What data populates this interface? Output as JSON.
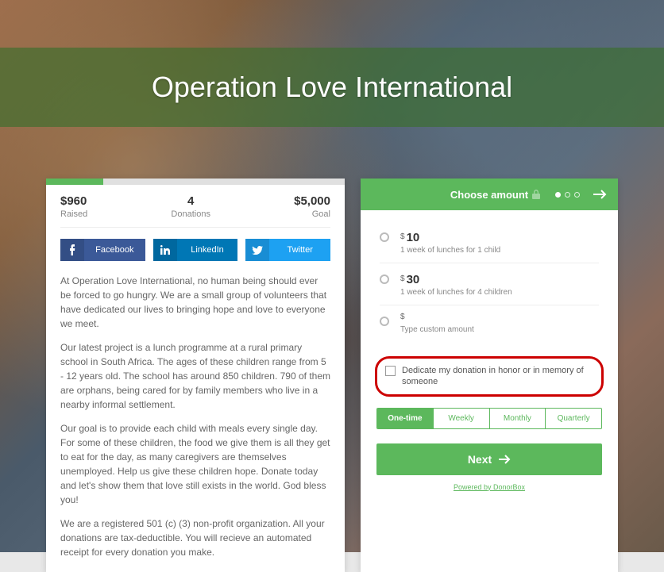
{
  "hero": {
    "title": "Operation Love International"
  },
  "stats": {
    "raised": {
      "value": "$960",
      "label": "Raised"
    },
    "donations": {
      "value": "4",
      "label": "Donations"
    },
    "goal": {
      "value": "$5,000",
      "label": "Goal"
    }
  },
  "social": {
    "facebook": "Facebook",
    "linkedin": "LinkedIn",
    "twitter": "Twitter"
  },
  "description": {
    "p1": "At Operation Love International, no human being should ever be forced to go hungry. We are a small group of volunteers that have dedicated our lives to bringing hope and love to everyone we meet.",
    "p2": "Our latest project is a lunch programme at a rural primary school in South Africa. The ages of these children range from 5 - 12 years old. The school has around 850 children. 790 of them are orphans, being cared for by family members who live in a nearby informal settlement.",
    "p3": "Our goal is to provide each child with meals every single day. For some of these children, the food we give them is all they get to eat for the day, as many caregivers are themselves unemployed. Help us give these children hope. Donate today and let's show them that love still exists in the world. God bless you!",
    "p4": "We are a registered 501 (c) (3) non-profit organization. All your donations are tax-deductible. You will recieve an automated receipt for every donation you make."
  },
  "donate": {
    "header": "Choose amount",
    "options": [
      {
        "amount": "10",
        "desc": "1 week of lunches for 1 child"
      },
      {
        "amount": "30",
        "desc": "1 week of lunches for 4 children"
      }
    ],
    "custom_desc": "Type custom amount",
    "dedicate": "Dedicate my donation in honor or in memory of someone",
    "frequency": {
      "onetime": "One-time",
      "weekly": "Weekly",
      "monthly": "Monthly",
      "quarterly": "Quarterly"
    },
    "next": "Next",
    "powered": "Powered by DonorBox"
  }
}
